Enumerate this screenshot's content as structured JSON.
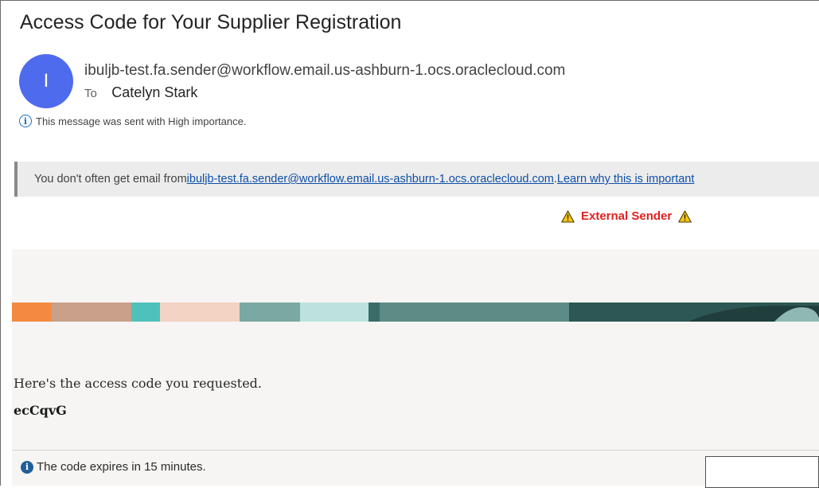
{
  "email": {
    "subject": "Access Code for Your Supplier Registration",
    "avatar_initial": "I",
    "sender": "ibuljb-test.fa.sender@workflow.email.us-ashburn-1.ocs.oraclecloud.com",
    "to_label": "To",
    "recipient": "Catelyn Stark",
    "importance_notice": "This message was sent with High importance."
  },
  "safety_notice": {
    "prefix": "You don't often get email from ",
    "sender_link": "ibuljb-test.fa.sender@workflow.email.us-ashburn-1.ocs.oraclecloud.com",
    "separator": ". ",
    "learn_link": "Learn why this is important"
  },
  "external_banner": {
    "label": "External Sender"
  },
  "message": {
    "intro": "Here's the access code you requested.",
    "access_code": "ecCqvG",
    "expiry_note": "The code expires in 15 minutes."
  },
  "icons": {
    "info": "info-icon",
    "warning": "warning-icon"
  },
  "colors": {
    "avatar": "#4f6bed",
    "link": "#0f4fa8",
    "external_sender": "#e02020",
    "body_background": "#f6f5f3"
  }
}
